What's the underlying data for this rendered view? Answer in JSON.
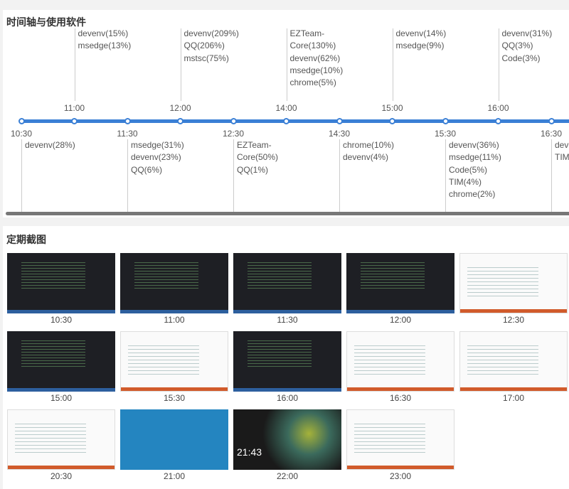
{
  "timeline": {
    "title": "时间轴与使用软件",
    "points": [
      {
        "time": "10:30",
        "pos": "bottom",
        "apps": [
          "devenv(28%)"
        ]
      },
      {
        "time": "11:00",
        "pos": "top",
        "apps": [
          "devenv(15%)",
          "msedge(13%)"
        ]
      },
      {
        "time": "11:30",
        "pos": "bottom",
        "apps": [
          "msedge(31%)",
          "devenv(23%)",
          "QQ(6%)"
        ]
      },
      {
        "time": "12:00",
        "pos": "top",
        "apps": [
          "devenv(209%)",
          "QQ(206%)",
          "mstsc(75%)"
        ]
      },
      {
        "time": "12:30",
        "pos": "bottom",
        "apps": [
          "EZTeam-",
          "Core(50%)",
          "QQ(1%)"
        ]
      },
      {
        "time": "14:00",
        "pos": "top",
        "apps": [
          "EZTeam-",
          "Core(130%)",
          "devenv(62%)",
          "msedge(10%)",
          "chrome(5%)"
        ]
      },
      {
        "time": "14:30",
        "pos": "bottom",
        "apps": [
          "chrome(10%)",
          "devenv(4%)"
        ]
      },
      {
        "time": "15:00",
        "pos": "top",
        "apps": [
          "devenv(14%)",
          "msedge(9%)"
        ]
      },
      {
        "time": "15:30",
        "pos": "bottom",
        "apps": [
          "devenv(36%)",
          "msedge(11%)",
          "Code(5%)",
          "TIM(4%)",
          "chrome(2%)"
        ]
      },
      {
        "time": "16:00",
        "pos": "top",
        "apps": [
          "devenv(31%)",
          "QQ(3%)",
          "Code(3%)"
        ]
      },
      {
        "time": "16:30",
        "pos": "bottom",
        "apps": [
          "devenv(",
          "TIM("
        ]
      }
    ]
  },
  "screenshots": {
    "title": "定期截图",
    "items": [
      {
        "time": "10:30",
        "kind": "dark"
      },
      {
        "time": "11:00",
        "kind": "dark"
      },
      {
        "time": "11:30",
        "kind": "dark"
      },
      {
        "time": "12:00",
        "kind": "dark"
      },
      {
        "time": "12:30",
        "kind": "light"
      },
      {
        "time": "15:00",
        "kind": "dark"
      },
      {
        "time": "15:30",
        "kind": "light"
      },
      {
        "time": "16:00",
        "kind": "dark"
      },
      {
        "time": "16:30",
        "kind": "light"
      },
      {
        "time": "17:00",
        "kind": "light"
      },
      {
        "time": "20:30",
        "kind": "light"
      },
      {
        "time": "21:00",
        "kind": "blue"
      },
      {
        "time": "22:00",
        "kind": "wall",
        "overlay": "21:43"
      },
      {
        "time": "23:00",
        "kind": "light"
      }
    ]
  }
}
